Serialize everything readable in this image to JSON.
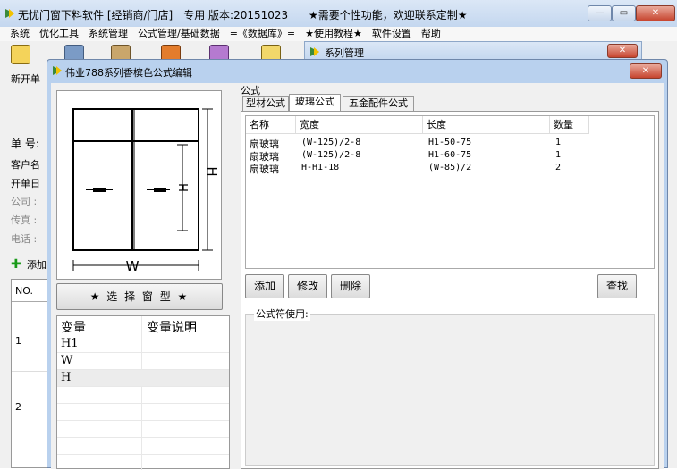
{
  "main_window": {
    "title": "无忧门窗下料软件 [经销商/门店]__专用 版本:20151023",
    "notice": "★需要个性功能，欢迎联系定制★",
    "menu": [
      "系统",
      "优化工具",
      "系统管理",
      "公式管理/基础数据",
      "=《数据库》=",
      "★使用教程★",
      "软件设置",
      "帮助"
    ],
    "toolbar_label": "新开单",
    "side_labels": [
      "单 号:",
      "客户名",
      "开单日",
      "公司 :",
      "传真 :",
      "电话 :"
    ],
    "add_label": "添加",
    "table_header": "NO.",
    "table_rows": [
      "1",
      "2"
    ]
  },
  "series_window": {
    "title": "系列管理"
  },
  "dialog": {
    "title": "伟业788系列香槟色公式编辑",
    "select_button": "★ 选 择 窗 型 ★",
    "window_preview": {
      "width_symbol": "W",
      "height_symbol": "H"
    },
    "variables": {
      "headers": [
        "变量",
        "变量说明"
      ],
      "rows": [
        "H1",
        "W",
        "H"
      ]
    },
    "formula_group_label": "公式",
    "tabs": [
      "型材公式",
      "玻璃公式",
      "五金配件公式"
    ],
    "active_tab": 1,
    "grid": {
      "headers": [
        "名称",
        "宽度",
        "长度",
        "数量"
      ],
      "rows": [
        [
          "扇玻璃",
          "(W-125)/2-8",
          "H1-50-75",
          "1"
        ],
        [
          "扇玻璃",
          "(W-125)/2-8",
          "H1-60-75",
          "1"
        ],
        [
          "扇玻璃",
          "H-H1-18",
          "(W-85)/2",
          "2"
        ]
      ]
    },
    "buttons": {
      "add": "添加",
      "edit": "修改",
      "delete": "删除",
      "search": "查找"
    },
    "hint_label": "公式符使用:"
  },
  "colors": {
    "titlebar": "#c4d7ef",
    "dialog_frame": "#b9d1ee",
    "close_button": "#c7452f"
  }
}
